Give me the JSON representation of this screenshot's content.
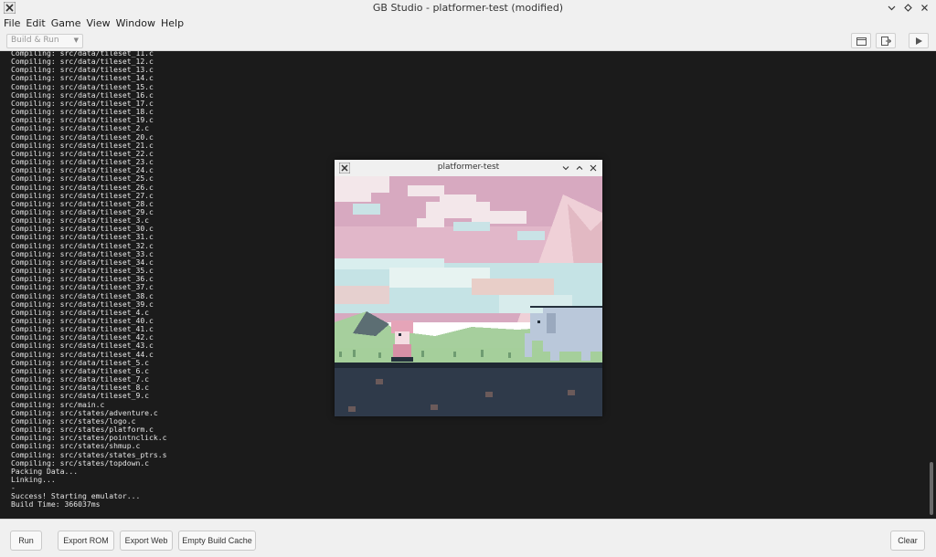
{
  "window": {
    "title": "GB Studio - platformer-test (modified)",
    "app_icon": "x-logo-icon",
    "controls": [
      "chevron-down-icon",
      "diamond-restore-icon",
      "close-icon"
    ]
  },
  "menu": [
    "File",
    "Edit",
    "Game",
    "View",
    "Window",
    "Help"
  ],
  "toolbar": {
    "build_select_value": "Build & Run",
    "buttons": [
      "folder-icon",
      "export-icon",
      "play-icon"
    ]
  },
  "console": {
    "lines": [
      "Compiling: src/data/tileset_11.c",
      "Compiling: src/data/tileset_12.c",
      "Compiling: src/data/tileset_13.c",
      "Compiling: src/data/tileset_14.c",
      "Compiling: src/data/tileset_15.c",
      "Compiling: src/data/tileset_16.c",
      "Compiling: src/data/tileset_17.c",
      "Compiling: src/data/tileset_18.c",
      "Compiling: src/data/tileset_19.c",
      "Compiling: src/data/tileset_2.c",
      "Compiling: src/data/tileset_20.c",
      "Compiling: src/data/tileset_21.c",
      "Compiling: src/data/tileset_22.c",
      "Compiling: src/data/tileset_23.c",
      "Compiling: src/data/tileset_24.c",
      "Compiling: src/data/tileset_25.c",
      "Compiling: src/data/tileset_26.c",
      "Compiling: src/data/tileset_27.c",
      "Compiling: src/data/tileset_28.c",
      "Compiling: src/data/tileset_29.c",
      "Compiling: src/data/tileset_3.c",
      "Compiling: src/data/tileset_30.c",
      "Compiling: src/data/tileset_31.c",
      "Compiling: src/data/tileset_32.c",
      "Compiling: src/data/tileset_33.c",
      "Compiling: src/data/tileset_34.c",
      "Compiling: src/data/tileset_35.c",
      "Compiling: src/data/tileset_36.c",
      "Compiling: src/data/tileset_37.c",
      "Compiling: src/data/tileset_38.c",
      "Compiling: src/data/tileset_39.c",
      "Compiling: src/data/tileset_4.c",
      "Compiling: src/data/tileset_40.c",
      "Compiling: src/data/tileset_41.c",
      "Compiling: src/data/tileset_42.c",
      "Compiling: src/data/tileset_43.c",
      "Compiling: src/data/tileset_44.c",
      "Compiling: src/data/tileset_5.c",
      "Compiling: src/data/tileset_6.c",
      "Compiling: src/data/tileset_7.c",
      "Compiling: src/data/tileset_8.c",
      "Compiling: src/data/tileset_9.c",
      "Compiling: src/main.c",
      "Compiling: src/states/adventure.c",
      "Compiling: src/states/logo.c",
      "Compiling: src/states/platform.c",
      "Compiling: src/states/pointnclick.c",
      "Compiling: src/states/shmup.c",
      "Compiling: src/states/states_ptrs.s",
      "Compiling: src/states/topdown.c",
      "Packing Data...",
      "Linking...",
      "-",
      "Success! Starting emulator...",
      "Build Time: 366037ms"
    ]
  },
  "emulator": {
    "title": "platformer-test",
    "app_icon": "x-logo-icon",
    "controls": [
      "chevron-down-icon",
      "chevron-up-icon",
      "close-icon"
    ],
    "scene": "gameboy-platformer-elephant-scene"
  },
  "footer": {
    "run": "Run",
    "export_rom": "Export ROM",
    "export_web": "Export Web",
    "empty_cache": "Empty Build Cache",
    "clear": "Clear"
  },
  "colors": {
    "console_bg": "#1b1b1b",
    "console_text": "#e6e6e6",
    "chrome_bg": "#f0f0f0",
    "sky_pink": "#d8a6bf",
    "cloud_white": "#f3e7ea",
    "grass_green": "#a5cf9b",
    "ground_dark": "#2f3a4a",
    "elephant_blue": "#b9c8dc"
  }
}
